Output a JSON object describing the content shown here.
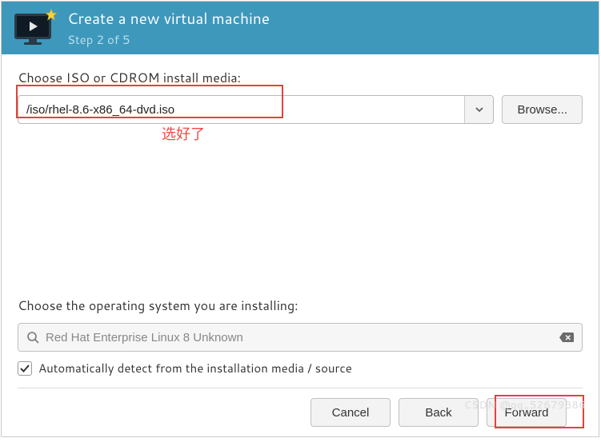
{
  "header": {
    "title": "Create a new virtual machine",
    "step": "Step 2 of 5"
  },
  "iso": {
    "label": "Choose ISO or CDROM install media:",
    "value": "/iso/rhel-8.6-x86_64-dvd.iso",
    "browse": "Browse..."
  },
  "os": {
    "label": "Choose the operating system you are installing:",
    "entry": "Red Hat Enterprise Linux 8 Unknown",
    "auto_detect": "Automatically detect from the installation media / source",
    "auto_checked": true
  },
  "footer": {
    "cancel": "Cancel",
    "back": "Back",
    "forward": "Forward"
  },
  "annotation": {
    "text": "选好了"
  },
  "watermark": "CSDN @qq_52679886"
}
